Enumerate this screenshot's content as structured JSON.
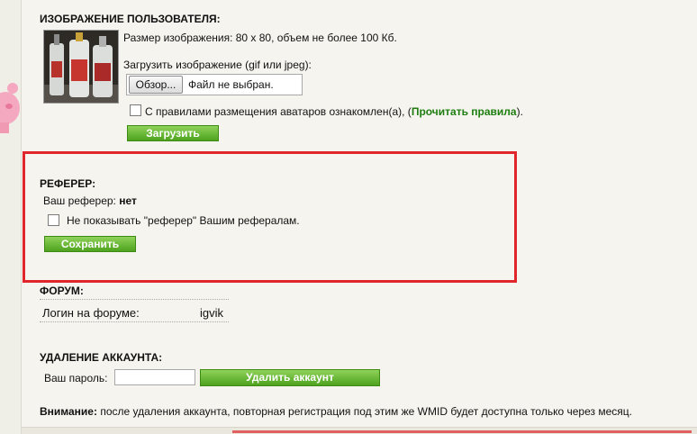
{
  "avatar": {
    "title": "ИЗОБРАЖЕНИЕ ПОЛЬЗОВАТЕЛЯ:",
    "size_info": "Размер изображения: 80 x 80, объем не более 100 Кб.",
    "upload_label": "Загрузить изображение (gif или jpeg):",
    "browse_label": "Обзор...",
    "file_status": "Файл не выбран.",
    "rules_text": "С правилами размещения аватаров ознакомлен(а), (",
    "rules_link": "Прочитать правила",
    "rules_close": ").",
    "upload_button": "Загрузить"
  },
  "referrer": {
    "title": "РЕФЕРЕР:",
    "label": "Ваш реферер:",
    "value": "нет",
    "hide_text": "Не показывать \"реферер\" Вашим рефералам.",
    "save_button": "Сохранить"
  },
  "forum": {
    "title": "ФОРУМ:",
    "login_label": "Логин на форуме:",
    "login_value": "igvik"
  },
  "delete_account": {
    "title": "УДАЛЕНИЕ АККАУНТА:",
    "password_label": "Ваш пароль:",
    "password_value": "",
    "delete_button": "Удалить аккаунт",
    "warning_label": "Внимание:",
    "warning_text": "после удаления аккаунта, повторная регистрация под этим же WMID будет доступна только через месяц."
  },
  "colors": {
    "highlight_frame": "#e0262b",
    "button_green": "#4ea21e",
    "link_green": "#1e7d10"
  }
}
